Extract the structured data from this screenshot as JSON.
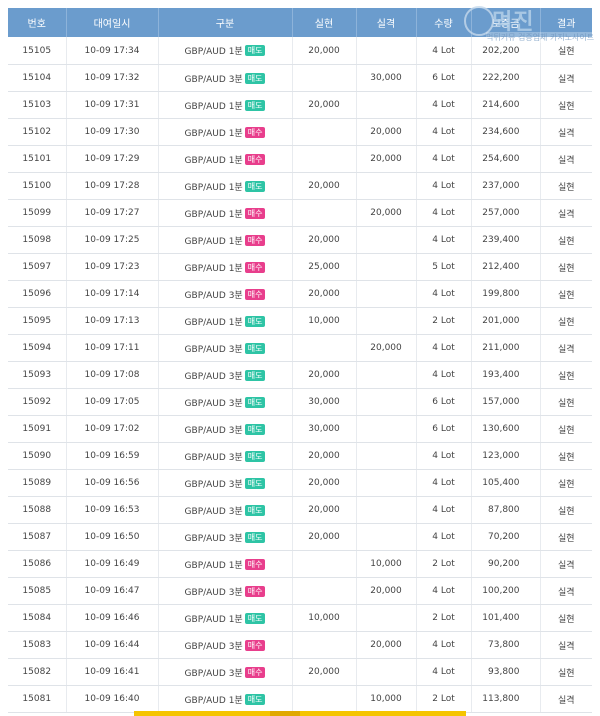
{
  "headers": [
    "번호",
    "대여일시",
    "구분",
    "실현",
    "실격",
    "수량",
    "보증금",
    "결과"
  ],
  "sell_badge": "매도",
  "buy_badge": "매수",
  "watermark": {
    "title": "먹진",
    "subtitle": "먹튀커뮤 검증업체 카지노사이트"
  },
  "colors": {
    "header_bg": "#6b9ccd",
    "profit": "#3fae95",
    "loss": "#d9403a",
    "sell_badge": "#2ec4a5",
    "buy_badge": "#e83e8c",
    "win": "#2f6fba"
  },
  "rows": [
    {
      "no": "15105",
      "datetime": "10-09 17:34",
      "pair": "GBP/AUD 1분",
      "side": "sell",
      "profit": "20,000",
      "loss": "",
      "qty": "4 Lot",
      "deposit": "202,200",
      "result": "실현"
    },
    {
      "no": "15104",
      "datetime": "10-09 17:32",
      "pair": "GBP/AUD 3분",
      "side": "sell",
      "profit": "",
      "loss": "30,000",
      "qty": "6 Lot",
      "deposit": "222,200",
      "result": "실격"
    },
    {
      "no": "15103",
      "datetime": "10-09 17:31",
      "pair": "GBP/AUD 1분",
      "side": "sell",
      "profit": "20,000",
      "loss": "",
      "qty": "4 Lot",
      "deposit": "214,600",
      "result": "실현"
    },
    {
      "no": "15102",
      "datetime": "10-09 17:30",
      "pair": "GBP/AUD 1분",
      "side": "buy",
      "profit": "",
      "loss": "20,000",
      "qty": "4 Lot",
      "deposit": "234,600",
      "result": "실격"
    },
    {
      "no": "15101",
      "datetime": "10-09 17:29",
      "pair": "GBP/AUD 1분",
      "side": "buy",
      "profit": "",
      "loss": "20,000",
      "qty": "4 Lot",
      "deposit": "254,600",
      "result": "실격"
    },
    {
      "no": "15100",
      "datetime": "10-09 17:28",
      "pair": "GBP/AUD 1분",
      "side": "sell",
      "profit": "20,000",
      "loss": "",
      "qty": "4 Lot",
      "deposit": "237,000",
      "result": "실현"
    },
    {
      "no": "15099",
      "datetime": "10-09 17:27",
      "pair": "GBP/AUD 1분",
      "side": "buy",
      "profit": "",
      "loss": "20,000",
      "qty": "4 Lot",
      "deposit": "257,000",
      "result": "실격"
    },
    {
      "no": "15098",
      "datetime": "10-09 17:25",
      "pair": "GBP/AUD 1분",
      "side": "buy",
      "profit": "20,000",
      "loss": "",
      "qty": "4 Lot",
      "deposit": "239,400",
      "result": "실현"
    },
    {
      "no": "15097",
      "datetime": "10-09 17:23",
      "pair": "GBP/AUD 1분",
      "side": "buy",
      "profit": "25,000",
      "loss": "",
      "qty": "5 Lot",
      "deposit": "212,400",
      "result": "실현"
    },
    {
      "no": "15096",
      "datetime": "10-09 17:14",
      "pair": "GBP/AUD 3분",
      "side": "buy",
      "profit": "20,000",
      "loss": "",
      "qty": "4 Lot",
      "deposit": "199,800",
      "result": "실현"
    },
    {
      "no": "15095",
      "datetime": "10-09 17:13",
      "pair": "GBP/AUD 1분",
      "side": "sell",
      "profit": "10,000",
      "loss": "",
      "qty": "2 Lot",
      "deposit": "201,000",
      "result": "실현"
    },
    {
      "no": "15094",
      "datetime": "10-09 17:11",
      "pair": "GBP/AUD 3분",
      "side": "sell",
      "profit": "",
      "loss": "20,000",
      "qty": "4 Lot",
      "deposit": "211,000",
      "result": "실격"
    },
    {
      "no": "15093",
      "datetime": "10-09 17:08",
      "pair": "GBP/AUD 3분",
      "side": "sell",
      "profit": "20,000",
      "loss": "",
      "qty": "4 Lot",
      "deposit": "193,400",
      "result": "실현"
    },
    {
      "no": "15092",
      "datetime": "10-09 17:05",
      "pair": "GBP/AUD 3분",
      "side": "sell",
      "profit": "30,000",
      "loss": "",
      "qty": "6 Lot",
      "deposit": "157,000",
      "result": "실현"
    },
    {
      "no": "15091",
      "datetime": "10-09 17:02",
      "pair": "GBP/AUD 3분",
      "side": "sell",
      "profit": "30,000",
      "loss": "",
      "qty": "6 Lot",
      "deposit": "130,600",
      "result": "실현"
    },
    {
      "no": "15090",
      "datetime": "10-09 16:59",
      "pair": "GBP/AUD 3분",
      "side": "sell",
      "profit": "20,000",
      "loss": "",
      "qty": "4 Lot",
      "deposit": "123,000",
      "result": "실현"
    },
    {
      "no": "15089",
      "datetime": "10-09 16:56",
      "pair": "GBP/AUD 3분",
      "side": "sell",
      "profit": "20,000",
      "loss": "",
      "qty": "4 Lot",
      "deposit": "105,400",
      "result": "실현"
    },
    {
      "no": "15088",
      "datetime": "10-09 16:53",
      "pair": "GBP/AUD 3분",
      "side": "sell",
      "profit": "20,000",
      "loss": "",
      "qty": "4 Lot",
      "deposit": "87,800",
      "result": "실현"
    },
    {
      "no": "15087",
      "datetime": "10-09 16:50",
      "pair": "GBP/AUD 3분",
      "side": "sell",
      "profit": "20,000",
      "loss": "",
      "qty": "4 Lot",
      "deposit": "70,200",
      "result": "실현"
    },
    {
      "no": "15086",
      "datetime": "10-09 16:49",
      "pair": "GBP/AUD 1분",
      "side": "buy",
      "profit": "",
      "loss": "10,000",
      "qty": "2 Lot",
      "deposit": "90,200",
      "result": "실격"
    },
    {
      "no": "15085",
      "datetime": "10-09 16:47",
      "pair": "GBP/AUD 3분",
      "side": "buy",
      "profit": "",
      "loss": "20,000",
      "qty": "4 Lot",
      "deposit": "100,200",
      "result": "실격"
    },
    {
      "no": "15084",
      "datetime": "10-09 16:46",
      "pair": "GBP/AUD 1분",
      "side": "sell",
      "profit": "10,000",
      "loss": "",
      "qty": "2 Lot",
      "deposit": "101,400",
      "result": "실현"
    },
    {
      "no": "15083",
      "datetime": "10-09 16:44",
      "pair": "GBP/AUD 3분",
      "side": "buy",
      "profit": "",
      "loss": "20,000",
      "qty": "4 Lot",
      "deposit": "73,800",
      "result": "실격"
    },
    {
      "no": "15082",
      "datetime": "10-09 16:41",
      "pair": "GBP/AUD 3분",
      "side": "buy",
      "profit": "20,000",
      "loss": "",
      "qty": "4 Lot",
      "deposit": "93,800",
      "result": "실현"
    },
    {
      "no": "15081",
      "datetime": "10-09 16:40",
      "pair": "GBP/AUD 1분",
      "side": "sell",
      "profit": "",
      "loss": "10,000",
      "qty": "2 Lot",
      "deposit": "113,800",
      "result": "실격"
    }
  ]
}
